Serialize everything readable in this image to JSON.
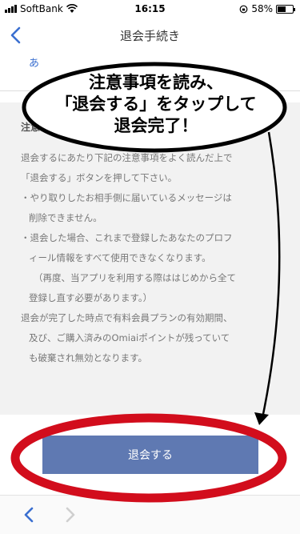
{
  "status_bar": {
    "carrier": "SoftBank",
    "time": "16:15",
    "battery_label": "58%",
    "battery_level": 0.58
  },
  "nav": {
    "title": "退会手続き",
    "back_icon": "chevron-left-icon"
  },
  "reason_field": {
    "value": "あ"
  },
  "notice": {
    "title": "注意事項",
    "lines": [
      "退会するにあたり下記の注意事項をよく読んだ上で",
      "「退会する」ボタンを押して下さい。",
      "・やり取りしたお相手側に届いているメッセージは",
      "削除できません。",
      "・退会した場合、これまで登録したあなたのプロフ",
      "ィール情報をすべて使用できなくなります。",
      "（再度、当アプリを利用する際ははじめから全て",
      "登録し直す必要があります。）",
      "退会が完了した時点で有料会員プランの有効期間、",
      "及び、ご購入済みのOmiaiポイントが残っていて",
      "も破棄され無効となります。"
    ]
  },
  "withdraw_button": {
    "label": "退会する"
  },
  "callout": {
    "lines": [
      "注意事項を読み、",
      "「退会する」をタップして",
      "退会完了！"
    ]
  },
  "colors": {
    "button": "#5f79b2",
    "accent": "#3a6fd0",
    "annotation_red": "#d20d1c",
    "panel": "#f2f2f2"
  }
}
